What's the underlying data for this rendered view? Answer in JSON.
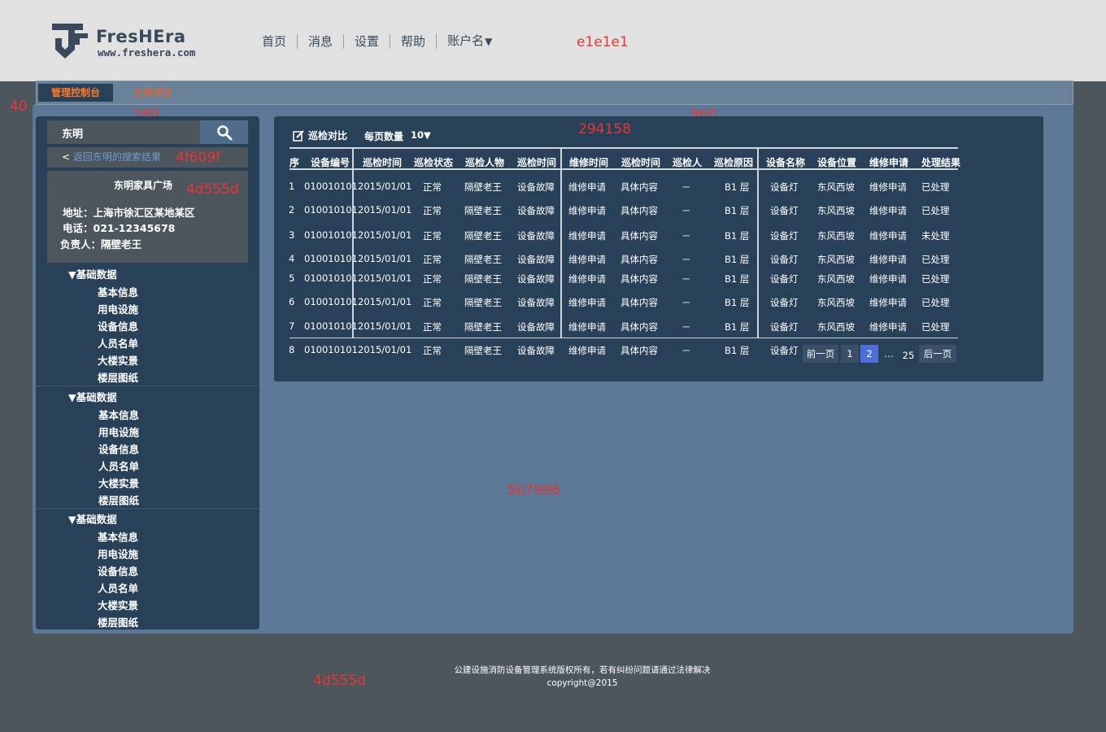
{
  "header": {
    "brand": "FresHEra",
    "url": "www.freshera.com",
    "nav": [
      "首页",
      "消息",
      "设置",
      "帮助",
      "账户名"
    ],
    "note": "e1e1e1"
  },
  "tabs": {
    "active": "管理控制台",
    "inactive": "全屏预览"
  },
  "notes": {
    "n40": "40",
    "n280": "280",
    "n960": "960",
    "n294158": "294158",
    "n4f609f": "4f609f",
    "n4d555d_card": "4d555d",
    "n5b7996": "5b7996",
    "n4d555d_footer": "4d555d"
  },
  "sidebar": {
    "search_value": "东明",
    "back_prefix": "< ",
    "back_link": "返回东明的搜索结果",
    "info": {
      "name": "东明家具广场",
      "address": "地址：上海市徐汇区某地某区",
      "phone": "电话：021-12345678",
      "owner": "负责人：隔壁老王"
    },
    "groups": [
      {
        "title": "▼基础数据",
        "items": [
          "基本信息",
          "用电设施",
          "设备信息",
          "人员名单",
          "大楼实景",
          "楼层图纸"
        ]
      },
      {
        "title": "▼基础数据",
        "items": [
          "基本信息",
          "用电设施",
          "设备信息",
          "人员名单",
          "大楼实景",
          "楼层图纸"
        ]
      },
      {
        "title": "▼基础数据",
        "items": [
          "基本信息",
          "用电设施",
          "设备信息",
          "人员名单",
          "大楼实景",
          "楼层图纸"
        ]
      }
    ]
  },
  "toolbar": {
    "compare": "巡检对比",
    "per_page_label": "每页数量",
    "per_page_value": "10▼"
  },
  "table": {
    "headers": [
      "序",
      "设备编号",
      "巡检时间",
      "巡检状态",
      "巡检人物",
      "巡检时间",
      "维修时间",
      "巡检时间",
      "巡检人",
      "巡检原因",
      "设备名称",
      "设备位置",
      "维修申请",
      "处理结果"
    ],
    "rows": [
      [
        "1",
        "010010101",
        "2015/01/01",
        "正常",
        "隔壁老王",
        "设备故障",
        "维修申请",
        "具体内容",
        "－",
        "B1 层",
        "设备灯",
        "东风西坡",
        "维修申请",
        "已处理"
      ],
      [
        "2",
        "010010101",
        "2015/01/01",
        "正常",
        "隔壁老王",
        "设备故障",
        "维修申请",
        "具体内容",
        "－",
        "B1 层",
        "设备灯",
        "东风西坡",
        "维修申请",
        "已处理"
      ],
      [
        "3",
        "010010101",
        "2015/01/01",
        "正常",
        "隔壁老王",
        "设备故障",
        "维修申请",
        "具体内容",
        "－",
        "B1 层",
        "设备灯",
        "东风西坡",
        "维修申请",
        "未处理"
      ],
      [
        "4",
        "010010101",
        "2015/01/01",
        "正常",
        "隔壁老王",
        "设备故障",
        "维修申请",
        "具体内容",
        "－",
        "B1 层",
        "设备灯",
        "东风西坡",
        "维修申请",
        "已处理"
      ],
      [
        "5",
        "010010101",
        "2015/01/01",
        "正常",
        "隔壁老王",
        "设备故障",
        "维修申请",
        "具体内容",
        "－",
        "B1 层",
        "设备灯",
        "东风西坡",
        "维修申请",
        "已处理"
      ],
      [
        "6",
        "010010101",
        "2015/01/01",
        "正常",
        "隔壁老王",
        "设备故障",
        "维修申请",
        "具体内容",
        "－",
        "B1 层",
        "设备灯",
        "东风西坡",
        "维修申请",
        "已处理"
      ],
      [
        "7",
        "010010101",
        "2015/01/01",
        "正常",
        "隔壁老王",
        "设备故障",
        "维修申请",
        "具体内容",
        "－",
        "B1 层",
        "设备灯",
        "东风西坡",
        "维修申请",
        "已处理"
      ],
      [
        "8",
        "010010101",
        "2015/01/01",
        "正常",
        "隔壁老王",
        "设备故障",
        "维修申请",
        "具体内容",
        "－",
        "B1 层",
        "设备灯"
      ]
    ]
  },
  "pager": {
    "prev": "前一页",
    "pages": [
      "1",
      "2"
    ],
    "active": "2",
    "ellipsis": "...",
    "last": "25",
    "next": "后一页"
  },
  "footer": {
    "line1": "公建设施消防设备管理系统版权所有，若有纠纷问题请通过法律解决",
    "line2": "copyright@2015"
  }
}
